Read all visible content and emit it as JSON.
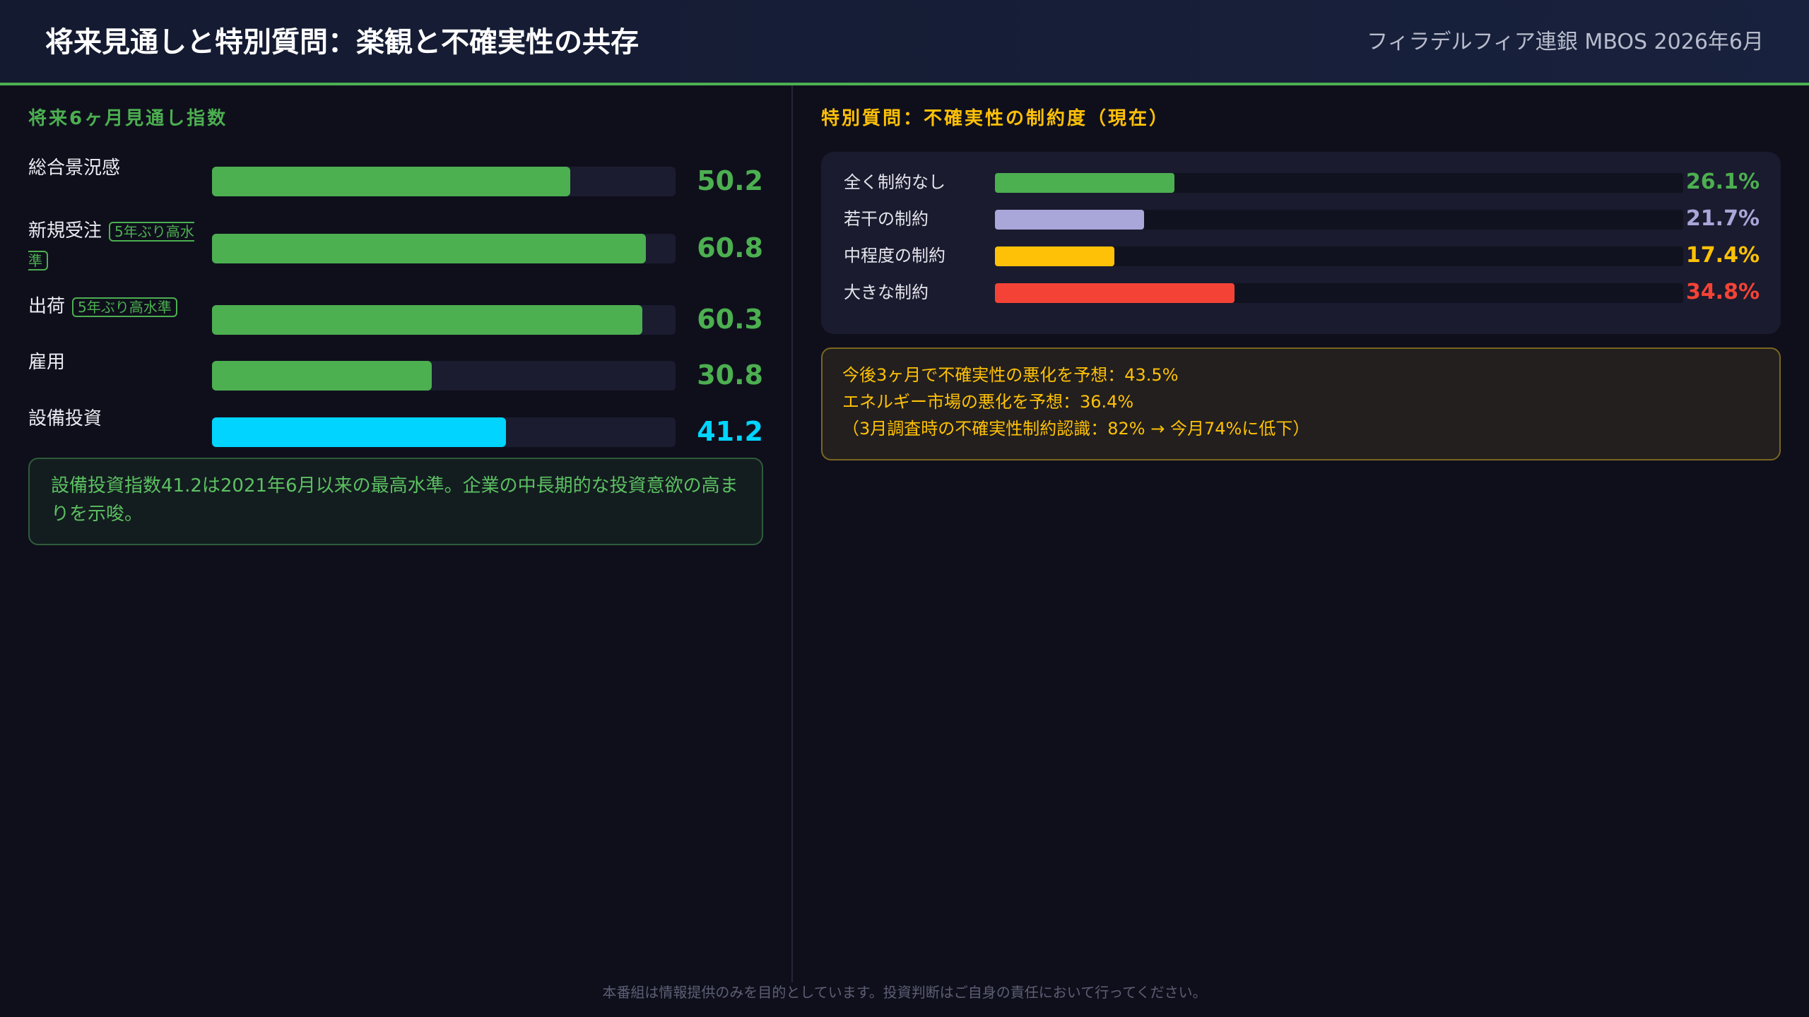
{
  "header": {
    "title": "将来見通しと特別質問：楽観と不確実性の共存",
    "source": "フィラデルフィア連銀 MBOS 2026年6月"
  },
  "colors": {
    "green": "#4caf50",
    "cyan": "#00d4ff",
    "lavender": "#a9a6d9",
    "yellow": "#ffc107",
    "red": "#f44336",
    "background": "#0f0f1c"
  },
  "outlook": {
    "section_title": "将来6ヶ月見通し指数",
    "scale_max": 65,
    "items": [
      {
        "label": "総合景況感",
        "badge": "",
        "value": "50.2",
        "color": "#4caf50"
      },
      {
        "label": "新規受注",
        "badge": "5年ぶり高水準",
        "value": "60.8",
        "color": "#4caf50"
      },
      {
        "label": "出荷",
        "badge": "5年ぶり高水準",
        "value": "60.3",
        "color": "#4caf50"
      },
      {
        "label": "雇用",
        "badge": "",
        "value": "30.8",
        "color": "#4caf50"
      },
      {
        "label": "設備投資",
        "badge": "",
        "value": "41.2",
        "color": "#00d4ff"
      }
    ],
    "note": "設備投資指数41.2は2021年6月以来の最高水準。企業の中長期的な投資意欲の高まりを示唆。"
  },
  "special": {
    "section_title": "特別質問：不確実性の制約度（現在）",
    "scale_max": 100,
    "items": [
      {
        "label": "全く制約なし",
        "value": "26.1%",
        "color": "#4caf50"
      },
      {
        "label": "若干の制約",
        "value": "21.7%",
        "color": "#a9a6d9"
      },
      {
        "label": "中程度の制約",
        "value": "17.4%",
        "color": "#ffc107"
      },
      {
        "label": "大きな制約",
        "value": "34.8%",
        "color": "#f44336"
      }
    ],
    "notes": [
      "今後3ヶ月で不確実性の悪化を予想：43.5%",
      "エネルギー市場の悪化を予想：36.4%",
      "（3月調査時の不確実性制約認識：82% → 今月74%に低下）"
    ]
  },
  "footer": "本番組は情報提供のみを目的としています。投資判断はご自身の責任において行ってください。"
}
